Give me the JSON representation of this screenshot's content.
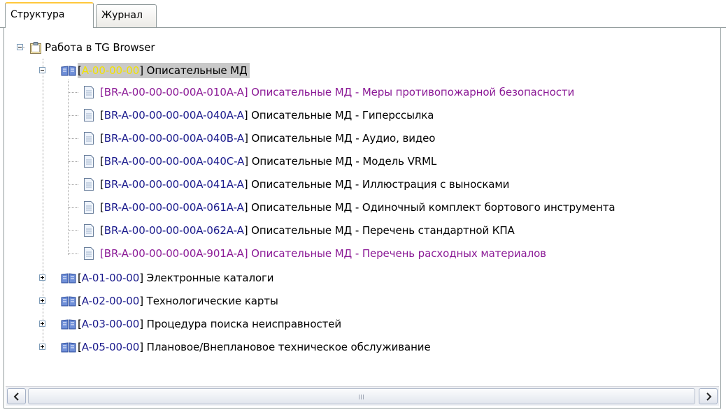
{
  "tabs": [
    {
      "label": "Структура",
      "active": true
    },
    {
      "label": "Журнал",
      "active": false
    }
  ],
  "tree": {
    "root": {
      "label": "Работа в TG Browser",
      "expanded": true,
      "icon": "clipboard-icon"
    },
    "groups": [
      {
        "code": "A-00-00-00",
        "title": " Описательные МД",
        "expanded": true,
        "selected": true,
        "icon": "book-icon",
        "children": [
          {
            "code": "BR-A-00-00-00-00A-010A-A",
            "title": " Описательные МД - Меры противопожарной безопасности",
            "highlight": true
          },
          {
            "code": "BR-A-00-00-00-00A-040A-A",
            "title": " Описательные МД - Гиперссылка",
            "highlight": false
          },
          {
            "code": "BR-A-00-00-00-00A-040B-A",
            "title": " Описательные МД - Аудио, видео",
            "highlight": false
          },
          {
            "code": "BR-A-00-00-00-00A-040C-A",
            "title": " Описательные МД - Модель VRML",
            "highlight": false
          },
          {
            "code": "BR-A-00-00-00-00A-041A-A",
            "title": " Описательные МД - Иллюстрация с выносками",
            "highlight": false
          },
          {
            "code": "BR-A-00-00-00-00A-061A-A",
            "title": " Описательные МД - Одиночный комплект бортового инструмента",
            "highlight": false
          },
          {
            "code": "BR-A-00-00-00-00A-062A-A",
            "title": " Описательные МД - Перечень стандартной КПА",
            "highlight": false
          },
          {
            "code": "BR-A-00-00-00-00A-901A-A",
            "title": " Описательные МД - Перечень расходных материалов",
            "highlight": true
          }
        ]
      },
      {
        "code": "A-01-00-00",
        "title": " Электронные каталоги",
        "expanded": false,
        "icon": "book-icon"
      },
      {
        "code": "A-02-00-00",
        "title": " Технологические карты",
        "expanded": false,
        "icon": "book-icon"
      },
      {
        "code": "A-03-00-00",
        "title": " Процедура поиска неисправностей",
        "expanded": false,
        "icon": "book-icon"
      },
      {
        "code": "A-05-00-00",
        "title": " Плановое/Внеплановое техническое обслуживание",
        "expanded": false,
        "icon": "book-icon"
      }
    ]
  },
  "scrollbar": {
    "left_icon": "chevron-left-icon",
    "right_icon": "chevron-right-icon",
    "grip": "III"
  },
  "punct": {
    "open": "[",
    "close": "]"
  },
  "colors": {
    "code": "#1a1a8c",
    "highlight": "#8b1a96",
    "selected_code": "#f2e200",
    "selection_bg": "#c9c9c9"
  }
}
